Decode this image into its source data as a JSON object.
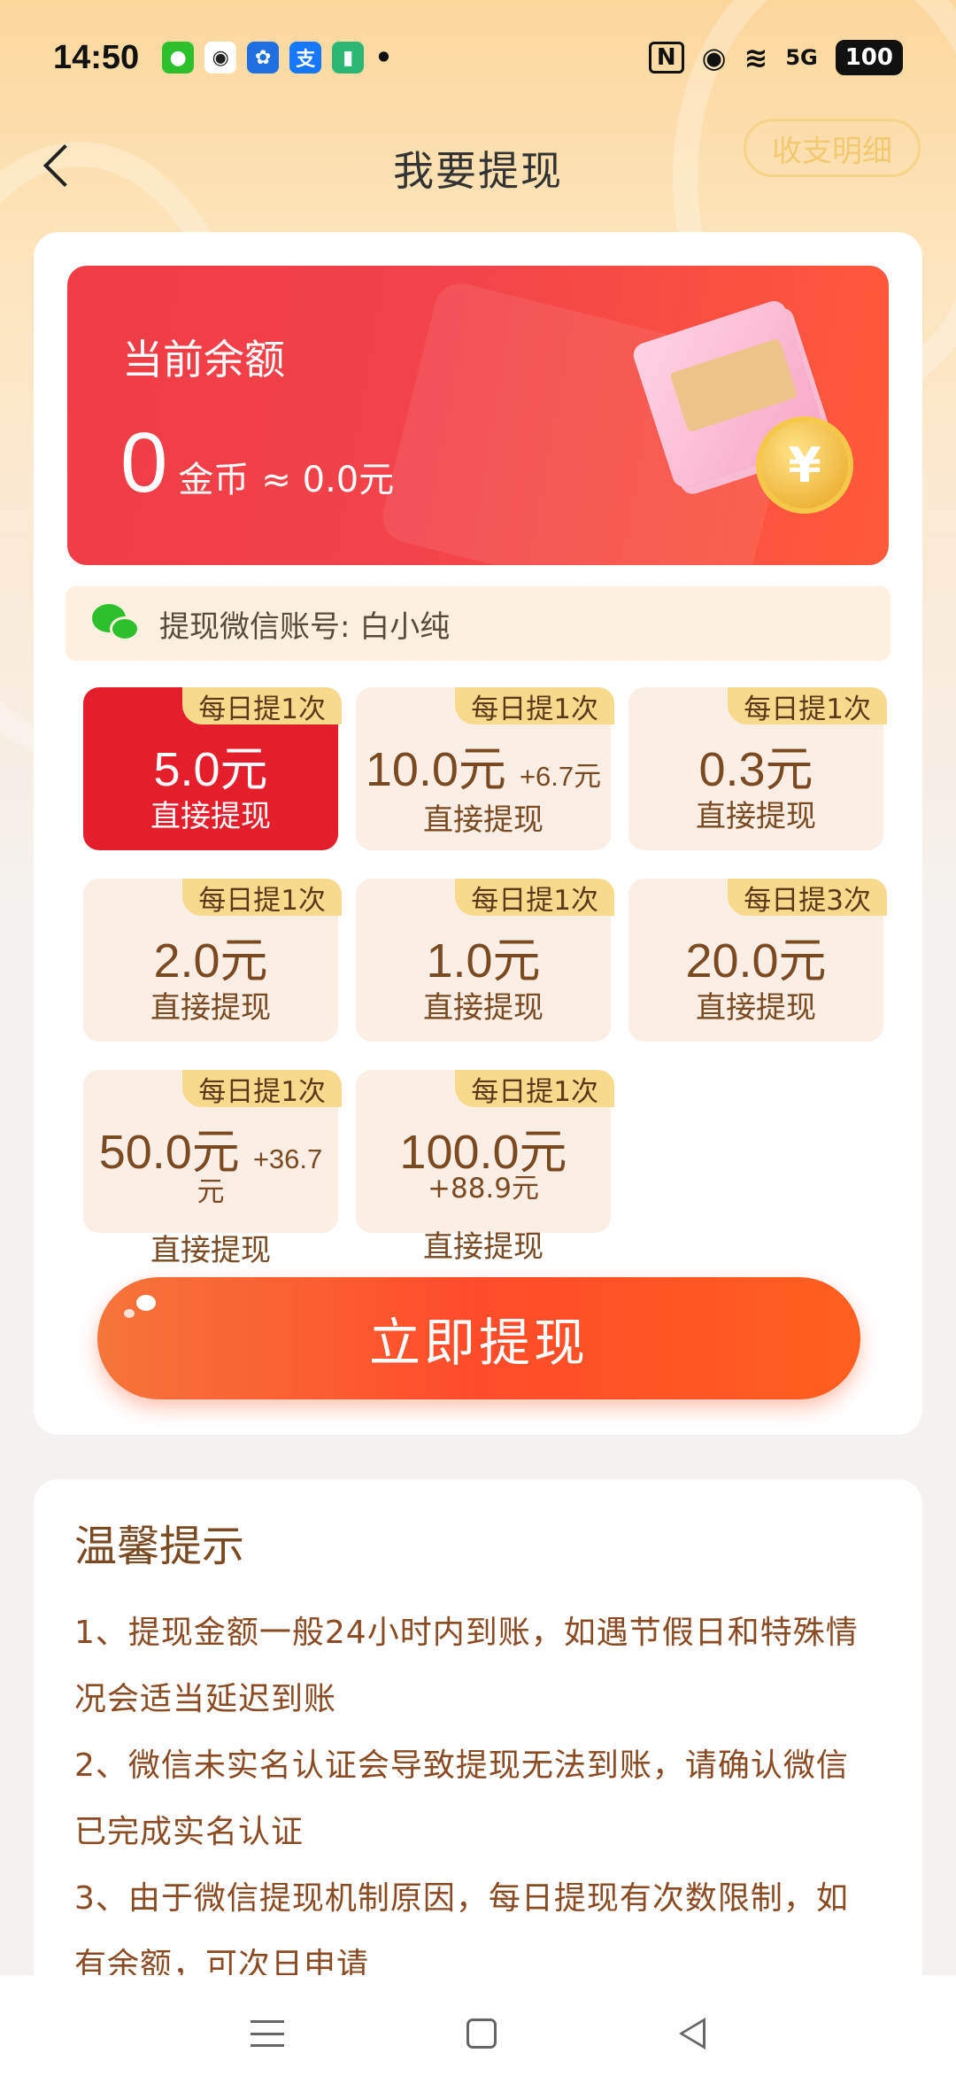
{
  "status_bar": {
    "time": "14:50",
    "apps": [
      {
        "name": "wechat-app-icon",
        "glyph": "●",
        "color": "#2cc12c"
      },
      {
        "name": "qq-app-icon",
        "glyph": "◉",
        "color": "#222222"
      },
      {
        "name": "pinwheel-app-icon",
        "glyph": "✿",
        "color": "#1f6fe0"
      },
      {
        "name": "alipay-app-icon",
        "glyph": "支",
        "color": "#1677ff"
      },
      {
        "name": "sim-app-icon",
        "glyph": "▮",
        "color": "#2bb673"
      }
    ],
    "dot": "•",
    "nfc": "N",
    "location": "◉",
    "wifi": "≋",
    "network": "5G",
    "battery": "100"
  },
  "header": {
    "title": "我要提现",
    "detail_label": "收支明细"
  },
  "balance": {
    "label": "当前余额",
    "value": "0",
    "unit": "金币",
    "approx": "≈ 0.0元",
    "coin_symbol": "¥"
  },
  "account": {
    "label": "提现微信账号: 白小纯"
  },
  "options": [
    {
      "badge": "每日提1次",
      "amount": "5.0元",
      "bonus": "",
      "sub": "直接提现",
      "selected": true
    },
    {
      "badge": "每日提1次",
      "amount": "10.0元",
      "bonus": "+6.7元",
      "sub": "直接提现",
      "selected": false
    },
    {
      "badge": "每日提1次",
      "amount": "0.3元",
      "bonus": "",
      "sub": "直接提现",
      "selected": false
    },
    {
      "badge": "每日提1次",
      "amount": "2.0元",
      "bonus": "",
      "sub": "直接提现",
      "selected": false
    },
    {
      "badge": "每日提1次",
      "amount": "1.0元",
      "bonus": "",
      "sub": "直接提现",
      "selected": false
    },
    {
      "badge": "每日提3次",
      "amount": "20.0元",
      "bonus": "",
      "sub": "直接提现",
      "selected": false
    },
    {
      "badge": "每日提1次",
      "amount": "50.0元",
      "bonus": "+36.7",
      "bonus_line": "元",
      "sub": "直接提现",
      "selected": false
    },
    {
      "badge": "每日提1次",
      "amount": "100.0元",
      "bonus": "",
      "bonus_line": "+88.9元",
      "sub": "直接提现",
      "selected": false
    }
  ],
  "withdraw_button": "立即提现",
  "tips": {
    "title": "温馨提示",
    "lines": [
      "1、提现金额一般24小时内到账，如遇节假日和特殊情",
      "况会适当延迟到账",
      "2、微信未实名认证会导致提现无法到账，请确认微信",
      "已完成实名认证",
      "3、由于微信提现机制原因，每日提现有次数限制，如",
      "有余额，可次日申请"
    ]
  },
  "colors": {
    "accent_red": "#e51e2c",
    "button_orange": "#ff4b2a",
    "badge_yellow": "#f8da8c"
  }
}
